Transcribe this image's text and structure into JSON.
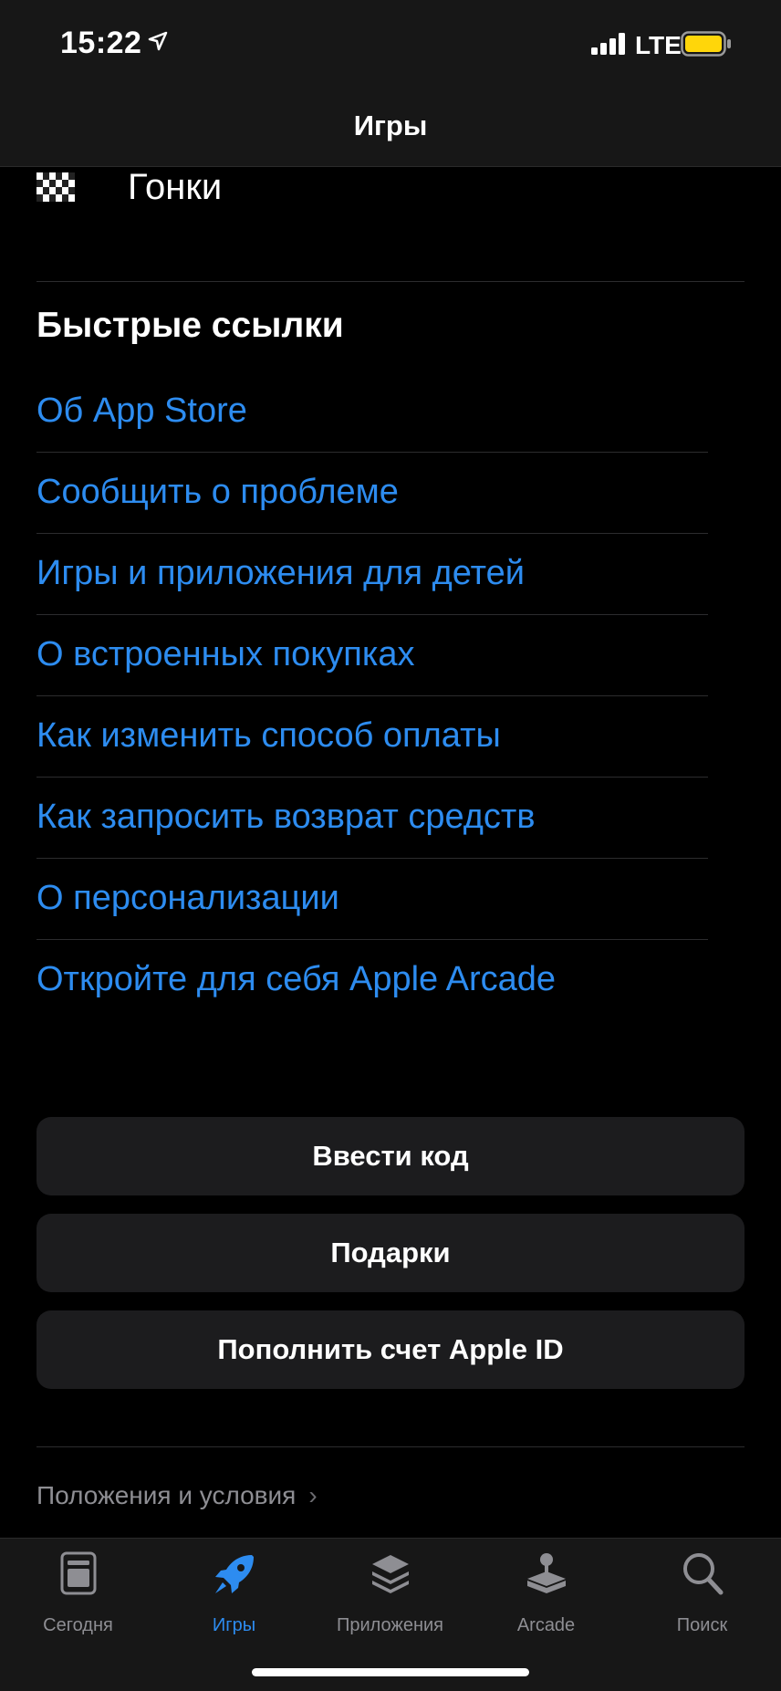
{
  "status_bar": {
    "time": "15:22",
    "network": "LTE",
    "battery_color": "#ffd60a"
  },
  "nav": {
    "title": "Игры"
  },
  "category": {
    "label": "Гонки",
    "icon": "checkered-flag-icon"
  },
  "quick_links": {
    "title": "Быстрые ссылки",
    "items": [
      "Об App Store",
      "Сообщить о проблеме",
      "Игры и приложения для детей",
      "О встроенных покупках",
      "Как изменить способ оплаты",
      "Как запросить возврат средств",
      "О персонализации",
      "Откройте для себя Apple Arcade"
    ]
  },
  "buttons": {
    "redeem": "Ввести код",
    "gifts": "Подарки",
    "add_funds": "Пополнить счет Apple ID"
  },
  "terms": {
    "label": "Положения и условия"
  },
  "tabs": [
    {
      "label": "Сегодня",
      "icon": "today-icon",
      "active": false
    },
    {
      "label": "Игры",
      "icon": "rocket-icon",
      "active": true
    },
    {
      "label": "Приложения",
      "icon": "apps-stack-icon",
      "active": false
    },
    {
      "label": "Arcade",
      "icon": "arcade-joystick-icon",
      "active": false
    },
    {
      "label": "Поиск",
      "icon": "search-icon",
      "active": false
    }
  ],
  "colors": {
    "accent": "#2d8cf0",
    "background": "#000000",
    "card": "#1c1c1e",
    "secondary_text": "#8e8e93"
  }
}
